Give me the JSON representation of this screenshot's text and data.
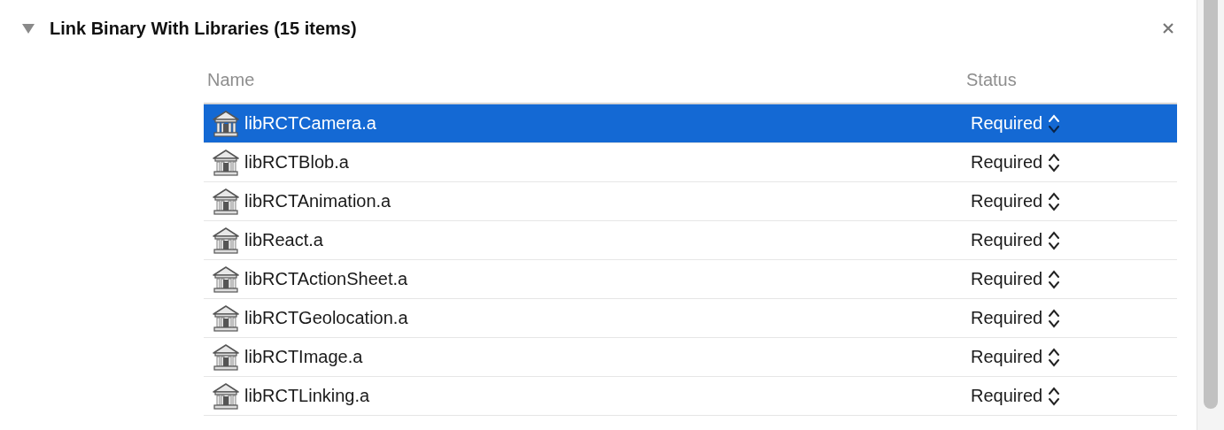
{
  "section": {
    "title": "Link Binary With Libraries (15 items)",
    "expanded": true
  },
  "table": {
    "columns": [
      "Name",
      "Status"
    ],
    "rows": [
      {
        "name": "libRCTCamera.a",
        "status": "Required",
        "selected": true
      },
      {
        "name": "libRCTBlob.a",
        "status": "Required",
        "selected": false
      },
      {
        "name": "libRCTAnimation.a",
        "status": "Required",
        "selected": false
      },
      {
        "name": "libReact.a",
        "status": "Required",
        "selected": false
      },
      {
        "name": "libRCTActionSheet.a",
        "status": "Required",
        "selected": false
      },
      {
        "name": "libRCTGeolocation.a",
        "status": "Required",
        "selected": false
      },
      {
        "name": "libRCTImage.a",
        "status": "Required",
        "selected": false
      },
      {
        "name": "libRCTLinking.a",
        "status": "Required",
        "selected": false
      }
    ]
  }
}
